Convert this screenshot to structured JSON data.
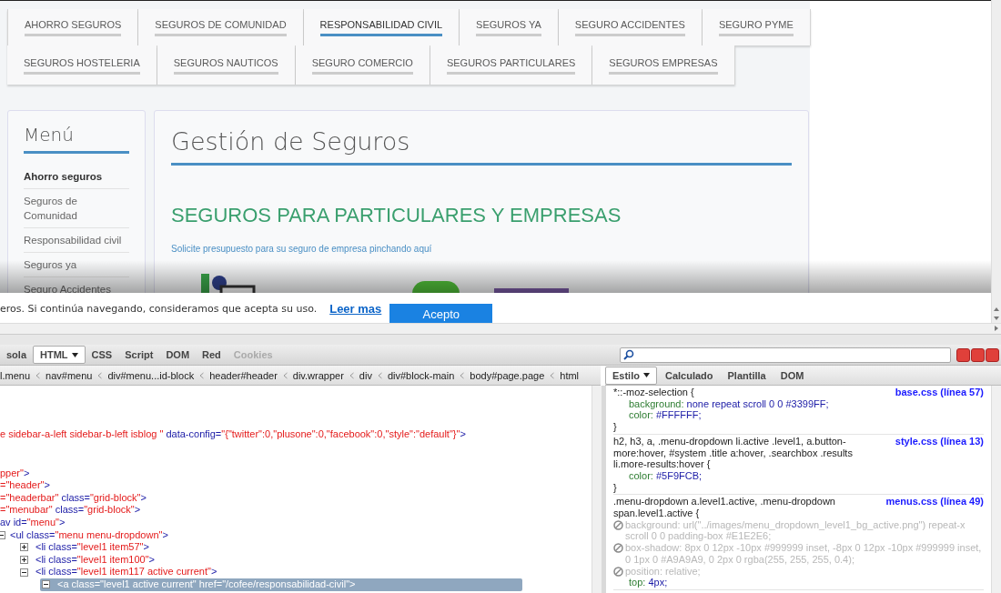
{
  "page": {
    "nav_rows": [
      [
        {
          "label": "AHORRO SEGUROS",
          "selected": false
        },
        {
          "label": "SEGUROS DE COMUNIDAD",
          "selected": false
        },
        {
          "label": "RESPONSABILIDAD CIVIL",
          "selected": true
        },
        {
          "label": "SEGUROS YA",
          "selected": false
        },
        {
          "label": "SEGURO ACCIDENTES",
          "selected": false
        },
        {
          "label": "SEGURO PYME",
          "selected": false
        }
      ],
      [
        {
          "label": "SEGUROS HOSTELERIA",
          "selected": false
        },
        {
          "label": "SEGUROS NAUTICOS",
          "selected": false
        },
        {
          "label": "SEGURO COMERCIO",
          "selected": false
        },
        {
          "label": "SEGUROS PARTICULARES",
          "selected": false
        },
        {
          "label": "SEGUROS EMPRESAS",
          "selected": false
        }
      ]
    ],
    "sidebar": {
      "title": "Menú",
      "items": [
        {
          "label": "Ahorro seguros",
          "selected": true
        },
        {
          "label": "Seguros de Comunidad",
          "selected": false
        },
        {
          "label": "Responsabilidad civil",
          "selected": false
        },
        {
          "label": "Seguros ya",
          "selected": false
        },
        {
          "label": "Seguro Accidentes",
          "selected": false
        }
      ]
    },
    "main": {
      "title": "Gestión de Seguros",
      "subtitle": "SEGUROS PARA PARTICULARES Y EMPRESAS",
      "link": "Solicite presupuesto para su seguro de empresa pinchando aquí"
    },
    "cookie_bar": {
      "text": "eros. Si continúa navegando, consideramos que acepta su uso.",
      "link": "Leer mas",
      "button": "Acepto"
    }
  },
  "devtools": {
    "tabs": [
      {
        "label": "sola",
        "selected": false,
        "disabled": false,
        "dropdown": false
      },
      {
        "label": "HTML",
        "selected": true,
        "disabled": false,
        "dropdown": true
      },
      {
        "label": "CSS",
        "selected": false,
        "disabled": false,
        "dropdown": false
      },
      {
        "label": "Script",
        "selected": false,
        "disabled": false,
        "dropdown": false
      },
      {
        "label": "DOM",
        "selected": false,
        "disabled": false,
        "dropdown": false
      },
      {
        "label": "Red",
        "selected": false,
        "disabled": false,
        "dropdown": false
      },
      {
        "label": "Cookies",
        "selected": false,
        "disabled": true,
        "dropdown": false
      }
    ],
    "breadcrumb": [
      "l.menu",
      "nav#menu",
      "div#menu...id-block",
      "header#header",
      "div.wrapper",
      "div",
      "div#block-main",
      "body#page.page",
      "html"
    ],
    "side_tabs": [
      {
        "label": "Estilo",
        "selected": true,
        "dropdown": true
      },
      {
        "label": "Calculado",
        "selected": false,
        "dropdown": false
      },
      {
        "label": "Plantilla",
        "selected": false,
        "dropdown": false
      },
      {
        "label": "DOM",
        "selected": false,
        "dropdown": false
      }
    ],
    "html_lines": [
      {
        "segments": [
          {
            "kind": "value",
            "text": "e sidebar-a-left sidebar-b-left isblog \""
          },
          {
            "kind": "markup",
            "text": " data-config="
          },
          {
            "kind": "value",
            "text": "\"{\"twitter\":0,\"plusone\":0,\"facebook\":0,\"style\":\"default\"}\""
          },
          {
            "kind": "markup",
            "text": ">"
          }
        ]
      },
      {
        "segments": [
          {
            "kind": "value",
            "text": "pper\""
          },
          {
            "kind": "markup",
            "text": ">"
          }
        ]
      },
      {
        "segments": [
          {
            "kind": "value",
            "text": "=\"header\""
          },
          {
            "kind": "markup",
            "text": ">"
          }
        ]
      },
      {
        "segments": [
          {
            "kind": "value",
            "text": "=\"headerbar\""
          },
          {
            "kind": "markup",
            "text": " class="
          },
          {
            "kind": "value",
            "text": "\"grid-block\""
          },
          {
            "kind": "markup",
            "text": ">"
          }
        ]
      },
      {
        "segments": [
          {
            "kind": "value",
            "text": "=\"menubar\""
          },
          {
            "kind": "markup",
            "text": " class="
          },
          {
            "kind": "value",
            "text": "\"grid-block\""
          },
          {
            "kind": "markup",
            "text": ">"
          }
        ]
      },
      {
        "segments": [
          {
            "kind": "markup",
            "text": "av id="
          },
          {
            "kind": "value",
            "text": "\"menu\""
          },
          {
            "kind": "markup",
            "text": ">"
          }
        ]
      },
      {
        "segments": [
          {
            "kind": "markup",
            "text": "<ul class="
          },
          {
            "kind": "value",
            "text": "\"menu menu-dropdown\""
          },
          {
            "kind": "markup",
            "text": ">"
          }
        ],
        "expanded": true,
        "children": [
          {
            "segments": [
              {
                "kind": "markup",
                "text": "<li class="
              },
              {
                "kind": "value",
                "text": "\"level1 item57\""
              },
              {
                "kind": "markup",
                "text": ">"
              }
            ],
            "expanded": false
          },
          {
            "segments": [
              {
                "kind": "markup",
                "text": "<li class="
              },
              {
                "kind": "value",
                "text": "\"level1 item100\""
              },
              {
                "kind": "markup",
                "text": ">"
              }
            ],
            "expanded": false
          },
          {
            "segments": [
              {
                "kind": "markup",
                "text": "<li class="
              },
              {
                "kind": "value",
                "text": "\"level1 item117 active current\""
              },
              {
                "kind": "markup",
                "text": ">"
              }
            ],
            "expanded": true,
            "children": [
              {
                "text": "<a class=\"level1 active current\" href=\"/cofee/responsabilidad-civil\">",
                "expanded": true,
                "selected": true
              }
            ]
          }
        ]
      }
    ],
    "css_rules": [
      {
        "selector": "*::-moz-selection {",
        "source": "base.css (línea 57)",
        "properties": [
          {
            "name": "background:",
            "value": "none repeat scroll 0 0 #3399FF;",
            "disabled": false
          },
          {
            "name": "color:",
            "value": "#FFFFFF;",
            "disabled": false
          }
        ],
        "close": "}"
      },
      {
        "selector": "h2, h3, a, .menu-dropdown li.active .level1, a.button-more:hover, #system .title a:hover, .searchbox .results li.more-results:hover {",
        "source": "style.css (línea 13)",
        "properties": [
          {
            "name": "color:",
            "value": "#5F9FCB;",
            "disabled": false
          }
        ],
        "close": "}"
      },
      {
        "selector": ".menu-dropdown a.level1.active, .menu-dropdown span.level1.active {",
        "source": "menus.css (línea 49)",
        "properties": [
          {
            "name": "background:",
            "value": "url(\"../images/menu_dropdown_level1_bg_active.png\") repeat-x scroll 0 0 padding-box #E1E2E6;",
            "disabled": true
          },
          {
            "name": "box-shadow:",
            "value": "8px 0 12px -10px #999999 inset, -8px 0 12px -10px #999999 inset, 0 1px 0 #A9A9A9, 0 2px 0 rgba(255, 255, 255, 0.4);",
            "disabled": true
          },
          {
            "name": "position:",
            "value": "relative;",
            "disabled": true
          },
          {
            "name": "top:",
            "value": "4px;",
            "disabled": false
          }
        ]
      }
    ]
  }
}
